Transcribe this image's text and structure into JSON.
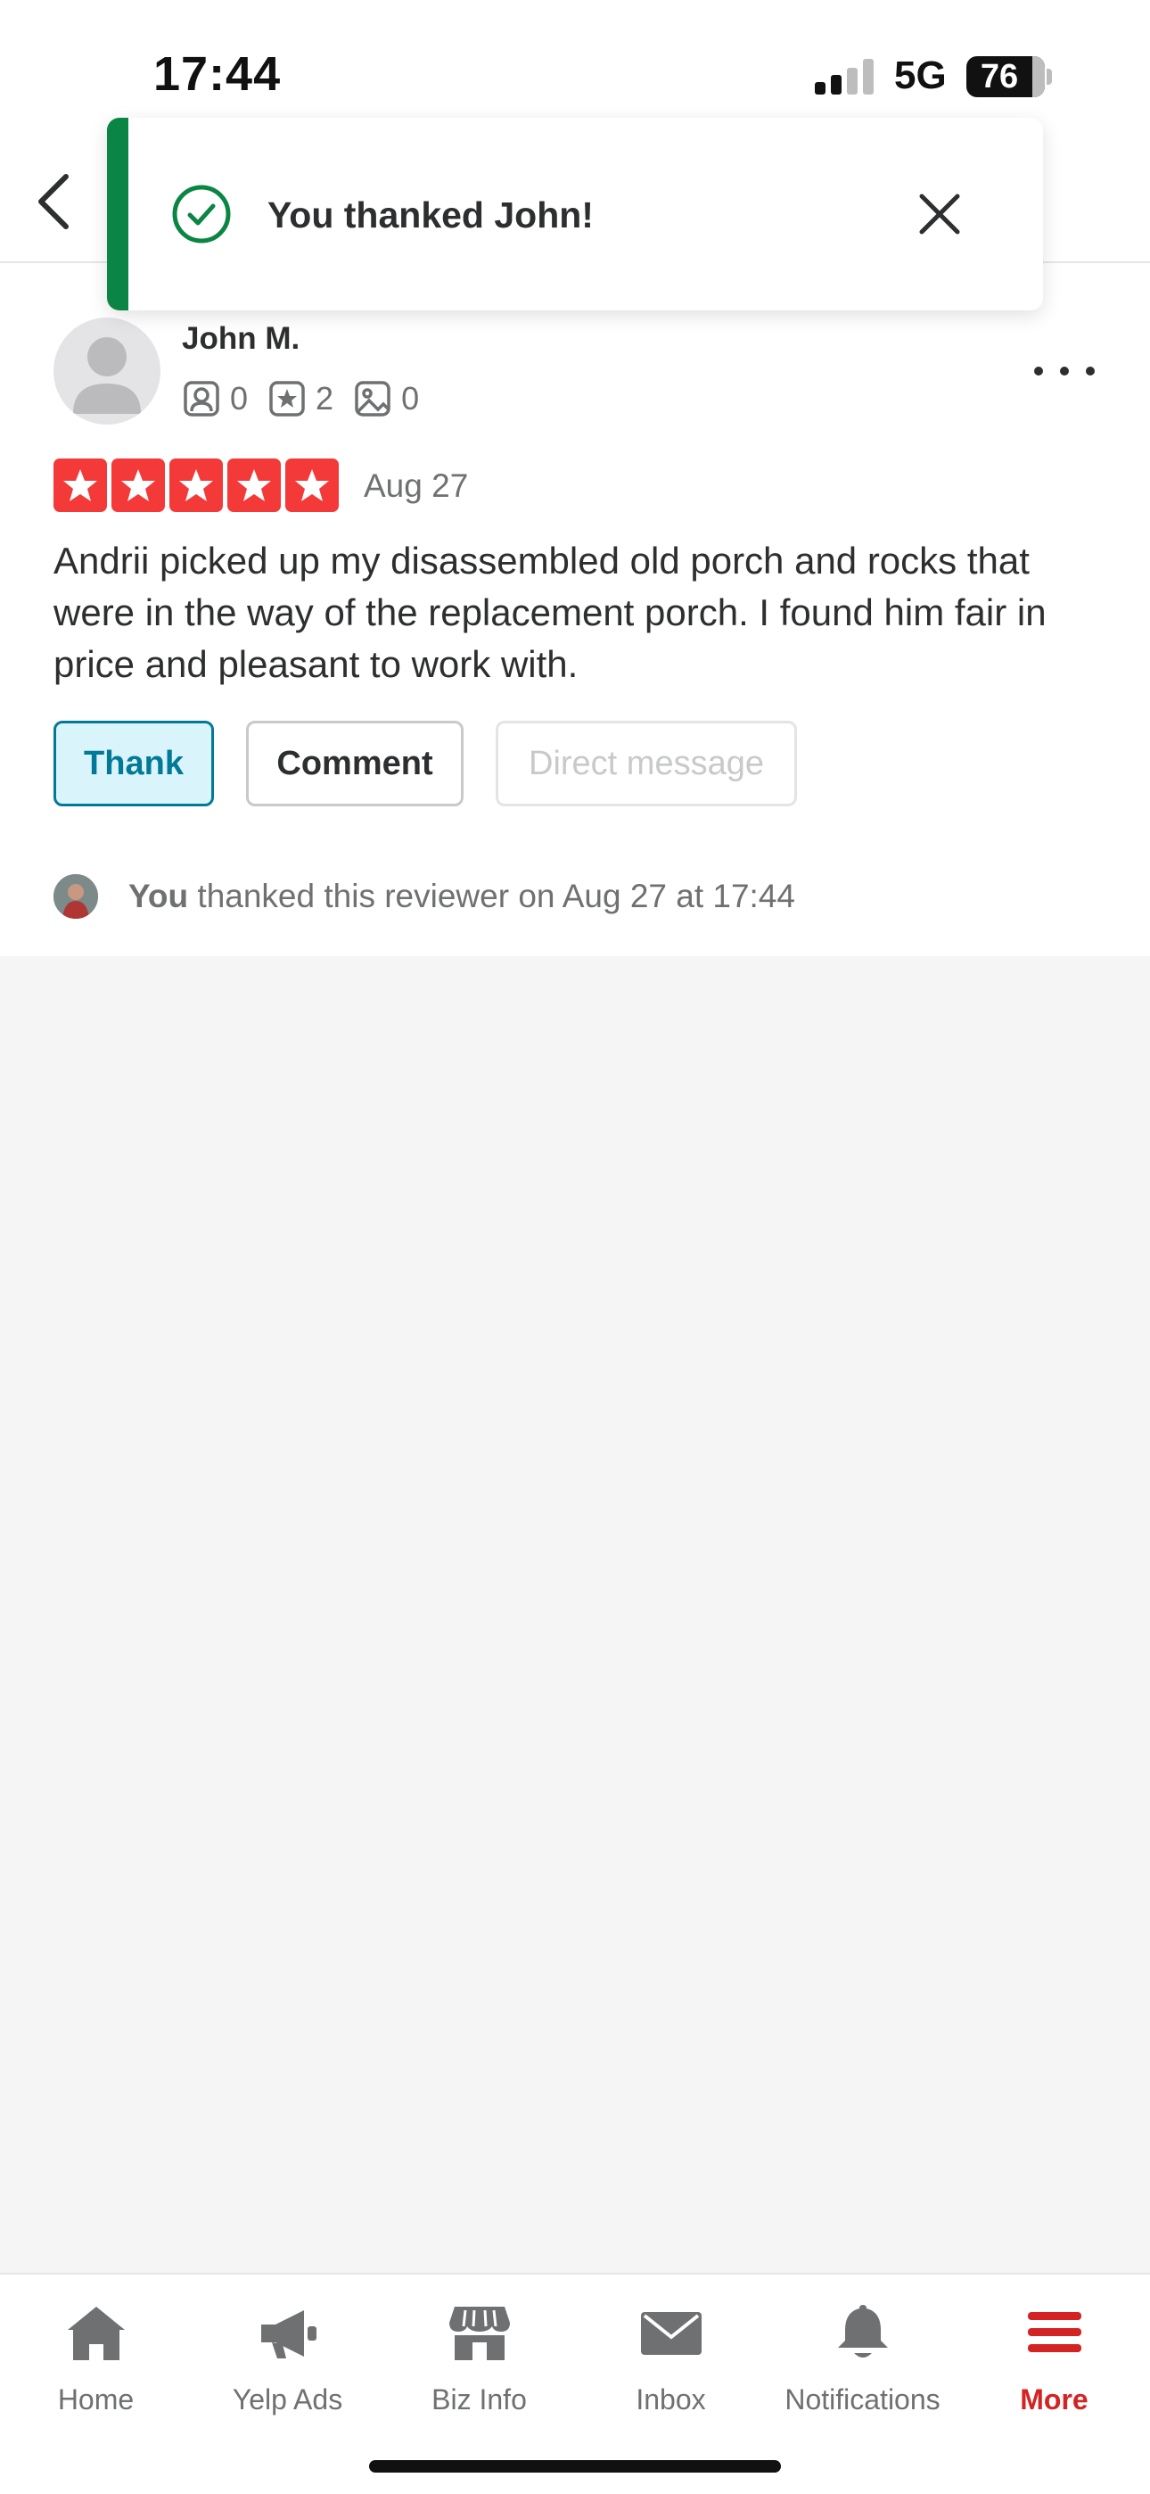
{
  "status_bar": {
    "time": "17:44",
    "network": "5G",
    "battery": "76"
  },
  "toast": {
    "message": "You thanked John!",
    "icon": "check-circle-icon",
    "accent_color": "#0b8543"
  },
  "review": {
    "reviewer_name": "John M.",
    "friends_count": "0",
    "reviews_count": "2",
    "photos_count": "0",
    "rating": 5,
    "date": "Aug 27",
    "text": "Andrii picked up my disassembled old porch and rocks that were in the way of the replacement porch.  I found him fair in price and pleasant to work with.",
    "star_color": "#f43939"
  },
  "actions": {
    "thank_label": "Thank",
    "comment_label": "Comment",
    "direct_message_label": "Direct message"
  },
  "thanked_note": {
    "actor": "You",
    "text": " thanked this reviewer on Aug 27 at 17:44"
  },
  "tabbar": {
    "items": [
      {
        "label": "Home",
        "icon": "home-icon"
      },
      {
        "label": "Yelp Ads",
        "icon": "megaphone-icon"
      },
      {
        "label": "Biz Info",
        "icon": "storefront-icon"
      },
      {
        "label": "Inbox",
        "icon": "envelope-icon"
      },
      {
        "label": "Notifications",
        "icon": "bell-icon"
      },
      {
        "label": "More",
        "icon": "hamburger-menu-icon"
      }
    ],
    "active_color": "#d32323"
  }
}
